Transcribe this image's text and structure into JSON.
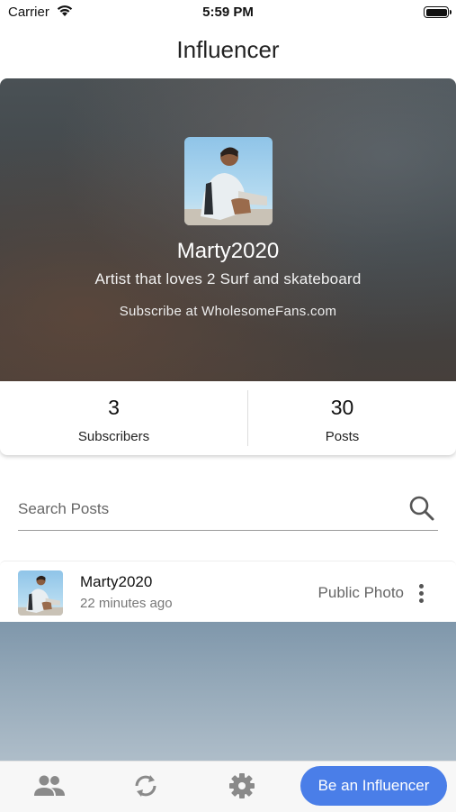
{
  "status_bar": {
    "carrier": "Carrier",
    "time": "5:59 PM"
  },
  "header": {
    "title": "Influencer"
  },
  "profile": {
    "username": "Marty2020",
    "bio": "Artist that loves 2 Surf and skateboard",
    "subscribe_text": "Subscribe at WholesomeFans.com"
  },
  "stats": {
    "subscribers_count": "3",
    "subscribers_label": "Subscribers",
    "posts_count": "30",
    "posts_label": "Posts"
  },
  "search": {
    "placeholder": "Search Posts",
    "value": ""
  },
  "post": {
    "author": "Marty2020",
    "time": "22 minutes ago",
    "type": "Public Photo"
  },
  "bottom_nav": {
    "items": [
      "people-icon",
      "refresh-icon",
      "settings-icon"
    ],
    "cta_label": "Be an Influencer"
  },
  "colors": {
    "accent": "#4a7ee8"
  }
}
